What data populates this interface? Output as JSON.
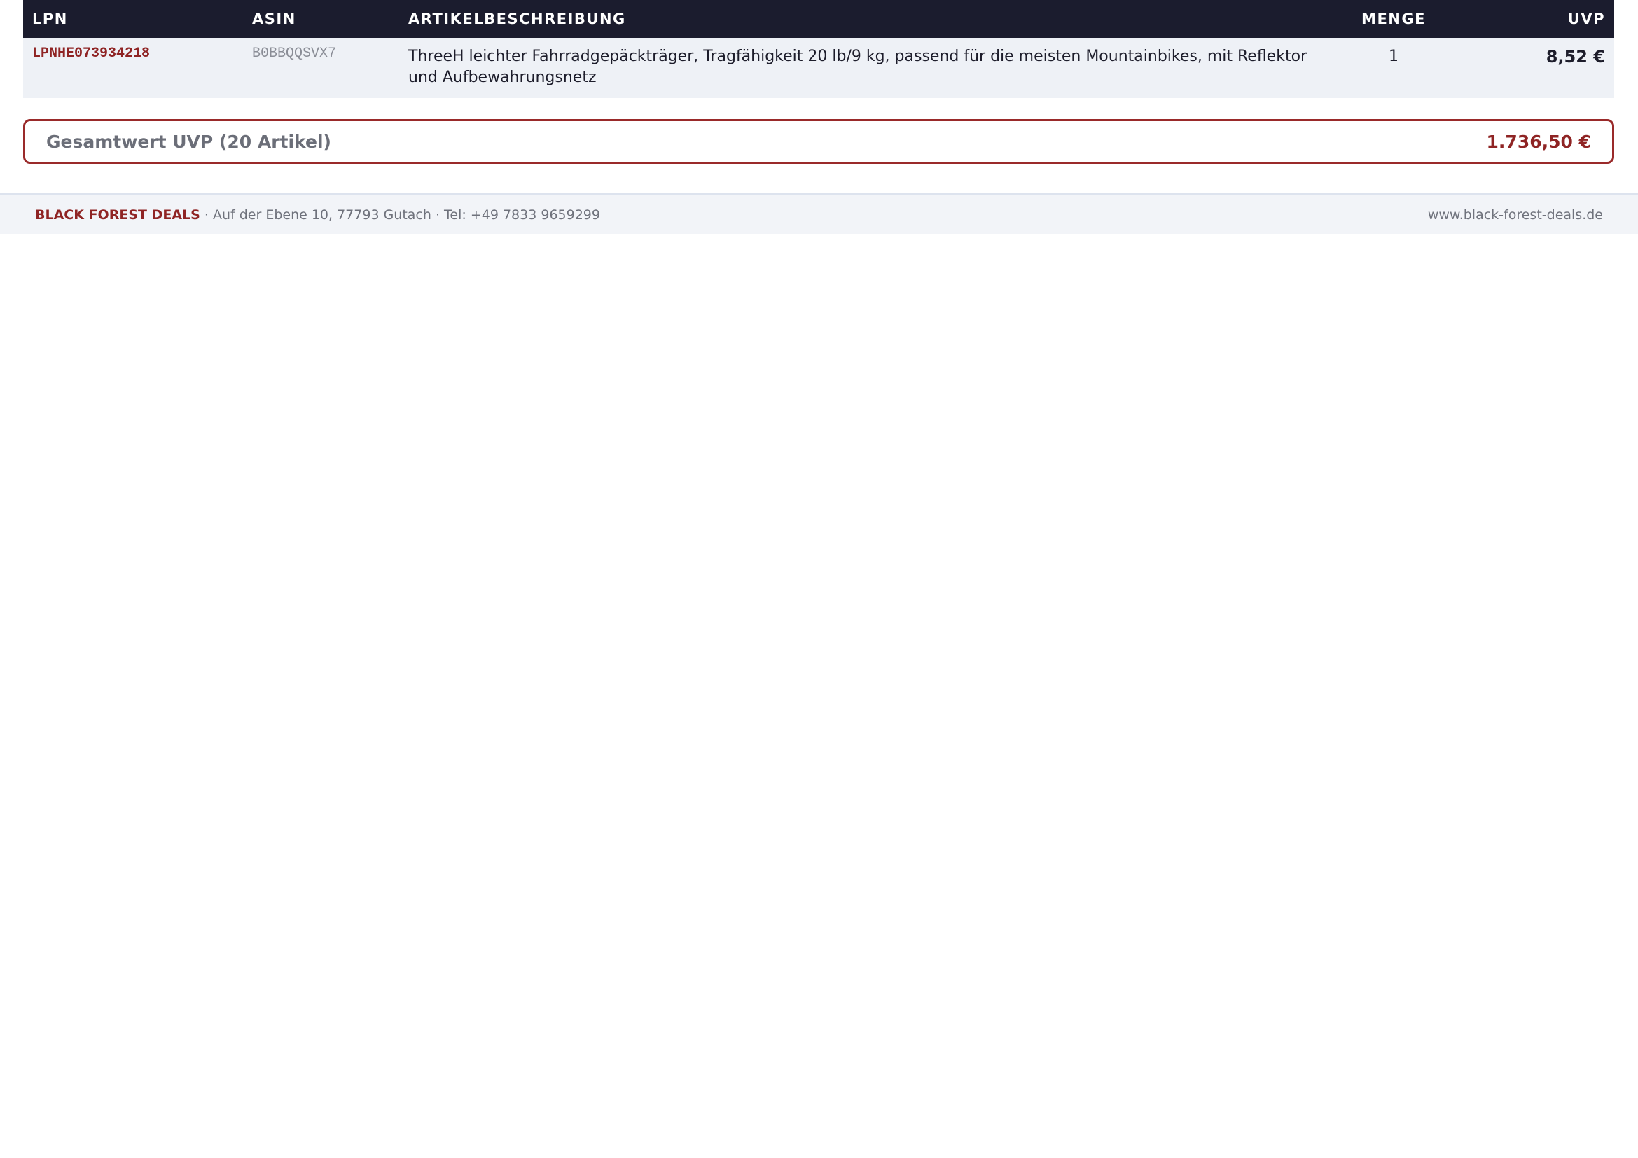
{
  "table": {
    "headers": {
      "lpn": "LPN",
      "asin": "ASIN",
      "description": "ARTIKELBESCHREIBUNG",
      "quantity": "MENGE",
      "uvp": "UVP"
    },
    "rows": [
      {
        "lpn": "LPNHE073934218",
        "asin": "B0BBQQSVX7",
        "description": "ThreeH leichter Fahrradgepäckträger, Tragfähigkeit 20 lb/9 kg, passend für die meisten Mountainbikes, mit Reflektor und Aufbewahrungsnetz",
        "quantity": "1",
        "uvp": "8,52 €"
      }
    ]
  },
  "total": {
    "label": "Gesamtwert UVP (20 Artikel)",
    "value": "1.736,50 €"
  },
  "footer": {
    "brand": "BLACK FOREST DEALS",
    "address": " · Auf der Ebene 10, 77793 Gutach · Tel: +49 7833 9659299",
    "website": "www.black-forest-deals.de"
  },
  "colors": {
    "header_bg": "#1b1c2e",
    "accent": "#8f2424",
    "row_bg": "#eef1f6"
  }
}
